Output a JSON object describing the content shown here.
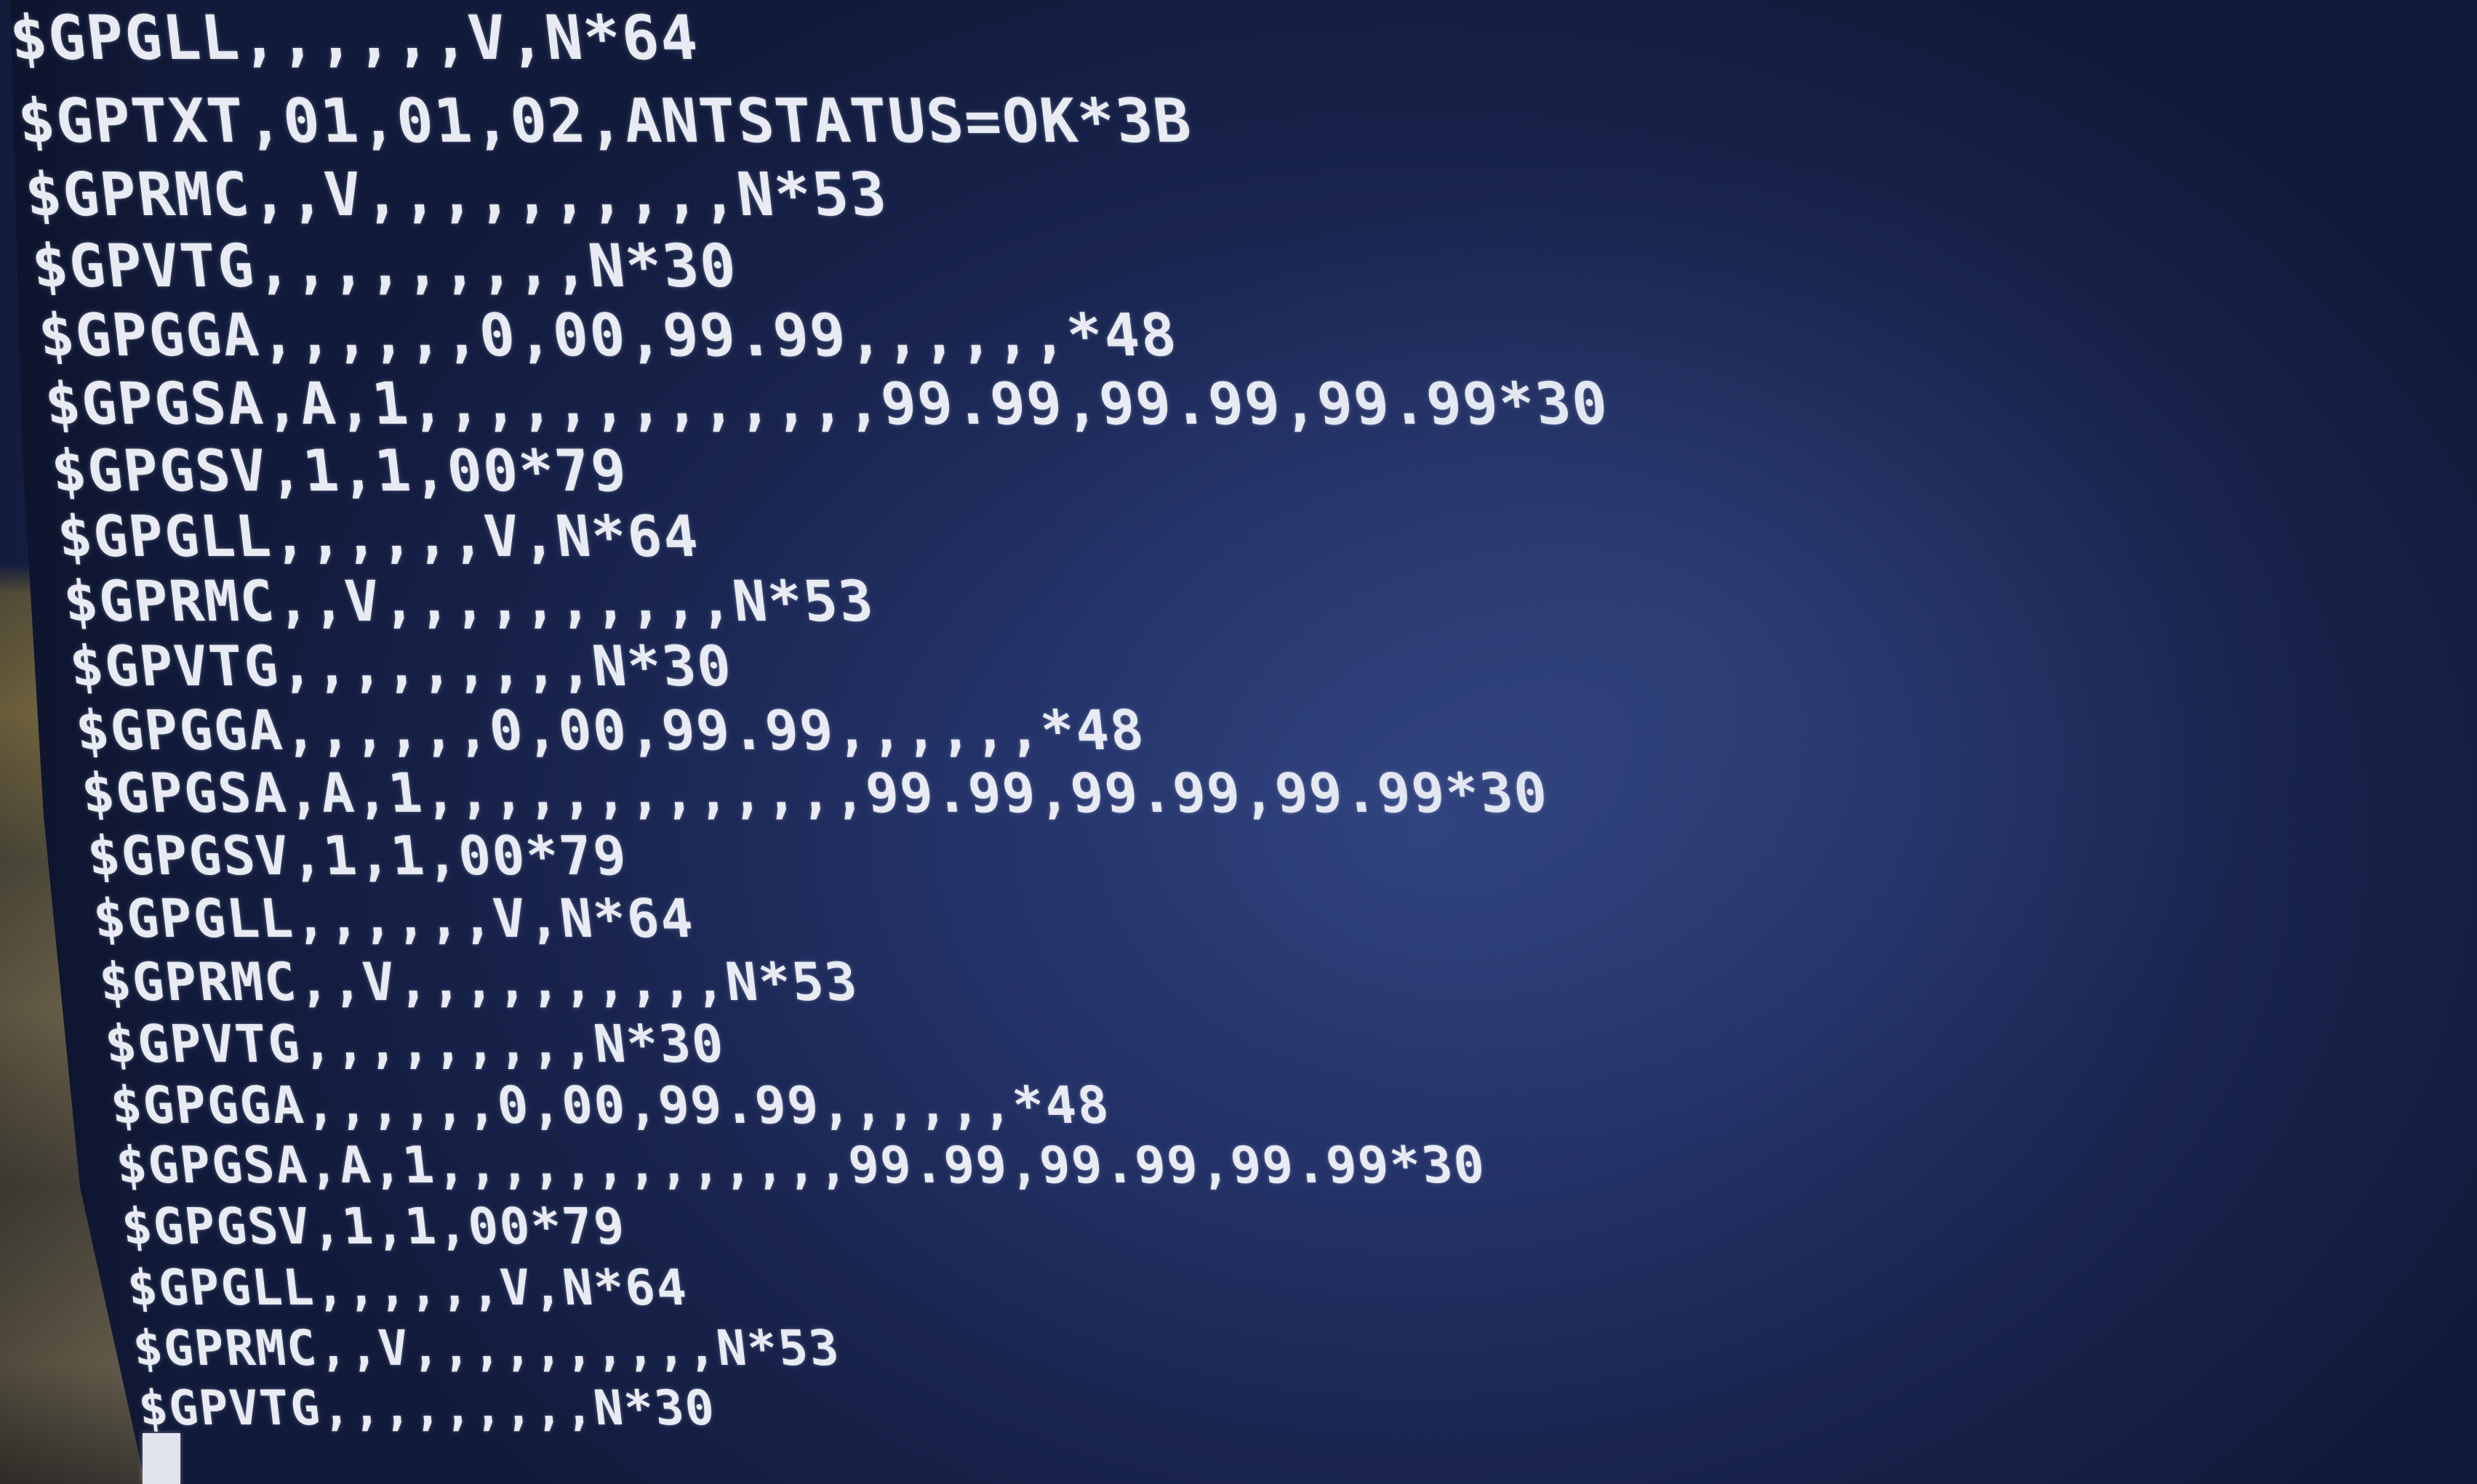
{
  "terminal": {
    "lines": [
      "$GPGLL,,,,,,V,N*64",
      "$GPTXT,01,01,02,ANTSTATUS=OK*3B",
      "$GPRMC,,V,,,,,,,,,,N*53",
      "$GPVTG,,,,,,,,,N*30",
      "$GPGGA,,,,,,0,00,99.99,,,,,,*48",
      "$GPGSA,A,1,,,,,,,,,,,,,99.99,99.99,99.99*30",
      "$GPGSV,1,1,00*79",
      "$GPGLL,,,,,,V,N*64",
      "$GPRMC,,V,,,,,,,,,,N*53",
      "$GPVTG,,,,,,,,,N*30",
      "$GPGGA,,,,,,0,00,99.99,,,,,,*48",
      "$GPGSA,A,1,,,,,,,,,,,,,99.99,99.99,99.99*30",
      "$GPGSV,1,1,00*79",
      "$GPGLL,,,,,,V,N*64",
      "$GPRMC,,V,,,,,,,,,,N*53",
      "$GPVTG,,,,,,,,,N*30",
      "$GPGGA,,,,,,0,00,99.99,,,,,,*48",
      "$GPGSA,A,1,,,,,,,,,,,,,99.99,99.99,99.99*30",
      "$GPGSV,1,1,00*79",
      "$GPGLL,,,,,,V,N*64",
      "$GPRMC,,V,,,,,,,,,,N*53",
      "$GPVTG,,,,,,,,,N*30"
    ]
  },
  "colors": {
    "background": "#243369",
    "text": "#e8ebf3"
  }
}
